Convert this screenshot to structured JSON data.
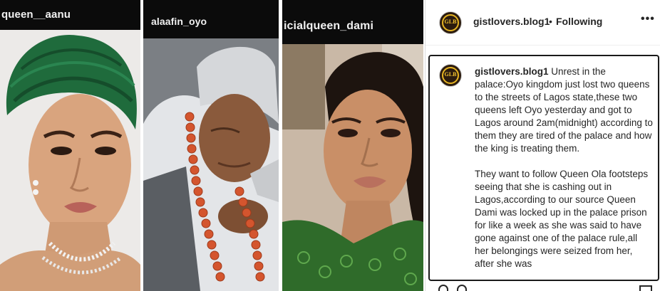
{
  "collage": {
    "photos": [
      {
        "handle": "queen__aanu"
      },
      {
        "handle": "alaafin_oyo"
      },
      {
        "handle": "icialqueen_dami"
      }
    ]
  },
  "post": {
    "account": "gistlovers.blog1",
    "separator": "•",
    "follow_status": "Following",
    "more_label": "•••",
    "avatar_text": "GLB",
    "caption_paragraphs": [
      "Unrest in the palace:Oyo kingdom just lost two queens to the streets of Lagos state,these two queens left Oyo yesterday and got to Lagos around 2am(midnight) according to them they are tired of the palace and how the king is treating them.",
      "They want to follow Queen Ola footsteps seeing that she is cashing out in Lagos,according to our source Queen Dami was locked up in the palace prison for like a week as she was said to have gone against one of the palace rule,all her belongings were seized from her, after she was"
    ]
  },
  "colors": {
    "gele_green": "#1f6b3c",
    "coral_beads": "#d4552e",
    "text": "#262626",
    "border": "#dbdbdb"
  }
}
